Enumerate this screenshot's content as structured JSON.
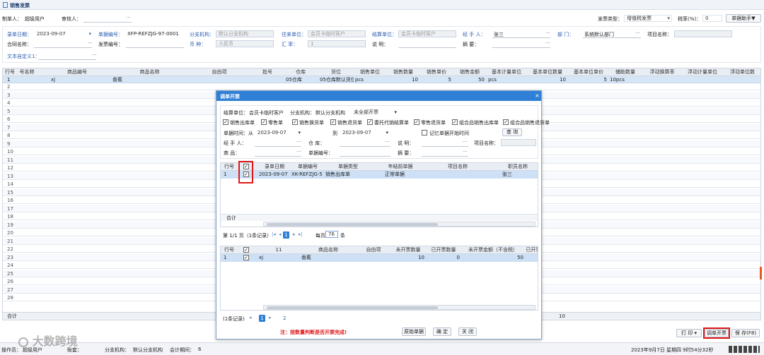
{
  "window_title": "销售发票",
  "top": {
    "maker_label": "制单人：",
    "maker_value": "超级用户",
    "reviewer_label": "审核人：",
    "invoice_type_label": "发票类型：",
    "invoice_type_value": "增值税发票",
    "tax_rate_label": "税率(%)：",
    "tax_rate_value": "0",
    "helper_button": "单据助手▼"
  },
  "form": {
    "entry_date_label": "录单日期：",
    "entry_date_value": "2023-09-07",
    "doc_no_label": "单据编号：",
    "doc_no_value": "XFP-REFZJG-97-0001",
    "branch_label": "分支机构：",
    "branch_value": "默认分支机构",
    "partner_label": "往来单位：",
    "partner_value": "会员卡临时客户",
    "settle_label": "结算单位：",
    "settle_value": "会员卡临时客户",
    "handler_label": "经  手  人：",
    "handler_value": "张三",
    "dept_label": "部      门：",
    "dept_value": "系统默认部门",
    "project_label": "项目名称：",
    "contract_label": "合同名称：",
    "invoice_no_label": "发票编号：",
    "currency_label": "币      种：",
    "currency_value": "人民币",
    "rate_label": "汇      率：",
    "rate_value": "1",
    "note_label": "说      明：",
    "summary_label": "摘      要：",
    "custom_label": "文本自定义1："
  },
  "main_table": {
    "headers": [
      "行号",
      "号名称",
      "商品编号",
      "商品名称",
      "自由项",
      "批号",
      "仓库",
      "货位",
      "销售单位",
      "销售数量",
      "销售单价",
      "销售金额",
      "基本计量单位",
      "基本单位数量",
      "基本单位单价",
      "辅助数量",
      "浮动换算率",
      "浮动计量单位",
      "浮动单位数"
    ],
    "row1": {
      "num": "1",
      "code": "xj",
      "name": "香蕉",
      "warehouse": "05仓库",
      "location": "05仓库默认货位",
      "unit": "pcs",
      "qty": "10",
      "price": "5",
      "amount": "50",
      "base_unit": "pcs",
      "base_qty": "10",
      "base_price": "5",
      "aux_qty": "10pcs"
    },
    "row_numbers": [
      "2",
      "3",
      "4",
      "5",
      "6",
      "7",
      "8",
      "9",
      "10",
      "11",
      "12",
      "13",
      "14",
      "15",
      "16",
      "17",
      "18",
      "19",
      "20",
      "21",
      "22",
      "23",
      "24",
      "25",
      "26",
      "27",
      "28"
    ],
    "total_label": "合计",
    "total_qty": "10"
  },
  "bottom": {
    "print_button": "打 印",
    "transfer_button": "调单开票",
    "save_button": "保 存(F8)"
  },
  "status": {
    "operator_label": "操作员：",
    "operator_value": "超级用户",
    "account_label": "账套：",
    "branch_label": "分支机构：",
    "branch_value": "默认分支机构",
    "period_label": "会计期间：",
    "period_value": "6",
    "datetime": "2023年9月7日 星期四 9时54分32秒"
  },
  "watermark": "大数跨境",
  "dialog": {
    "title": "调单开票",
    "close": "×",
    "settle_label": "结算单位：",
    "settle_value": "会员卡临时客户",
    "branch_label": "分支机构：",
    "branch_value": "默认分支机构",
    "filter_value": "未全部开票",
    "checks": [
      "销售出库单",
      "零售单",
      "销售换货单",
      "销售退货单",
      "委托代销结算单",
      "零售退货单",
      "组合品销售出库单",
      "组合品销售退货单"
    ],
    "date_label": "单据时间：从",
    "date_from": "2023-09-07",
    "date_to_label": "到",
    "date_to": "2023-09-07",
    "remember_label": "记忆单据开始时间",
    "query_button": "查 询",
    "handler_label": "经  手  人：",
    "warehouse_label": "仓      库：",
    "note_label": "说      明：",
    "project_label": "项目名称：",
    "product_label": "商      品：",
    "docno_label": "单据编号：",
    "summary_label": "摘      要：",
    "t1_headers": [
      "行号",
      "✓",
      "录单日期",
      "单据编号",
      "单据类型",
      "年结前单据",
      "项目名称",
      "职员名称"
    ],
    "t1_row": {
      "num": "1",
      "date": "2023-09-07",
      "docno": "XK-REFZJG-5",
      "type": "销售出库单",
      "status": "正常单据",
      "staff": "张三"
    },
    "t1_total": "合计",
    "pager1": {
      "page_text": "第 1/1 页（1条记录）",
      "page": "1",
      "per_label": "每页",
      "per_value": "76",
      "unit": "条"
    },
    "t2_headers": [
      "行号",
      "✓",
      "11",
      "商品名称",
      "自由项",
      "未开票数量",
      "已开票数量",
      "未开票金额（不含税）",
      "已开票"
    ],
    "t2_row": {
      "num": "1",
      "code": "xj",
      "name": "香蕉",
      "unbilled_qty": "10",
      "billed_qty": "0",
      "unbilled_amt": "50"
    },
    "pager2": {
      "records": "(1条记录)",
      "page": "1",
      "next": "2"
    },
    "warning": "注：按数量判断是否开票完成!",
    "orig_button": "原始单据",
    "ok_button": "确 定",
    "close_button": "关 闭"
  }
}
